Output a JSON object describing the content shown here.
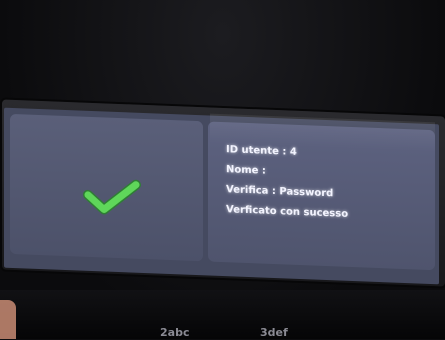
{
  "screen": {
    "status_icon": "checkmark-icon",
    "accent_color": "#5fd65a",
    "info": {
      "user_id": "ID utente : 4",
      "name": "Nome :",
      "verify_method": "Verifica : Password",
      "result": "Verficato con sucesso"
    }
  },
  "keypad": {
    "labels": [
      "2abc",
      "3def"
    ]
  }
}
